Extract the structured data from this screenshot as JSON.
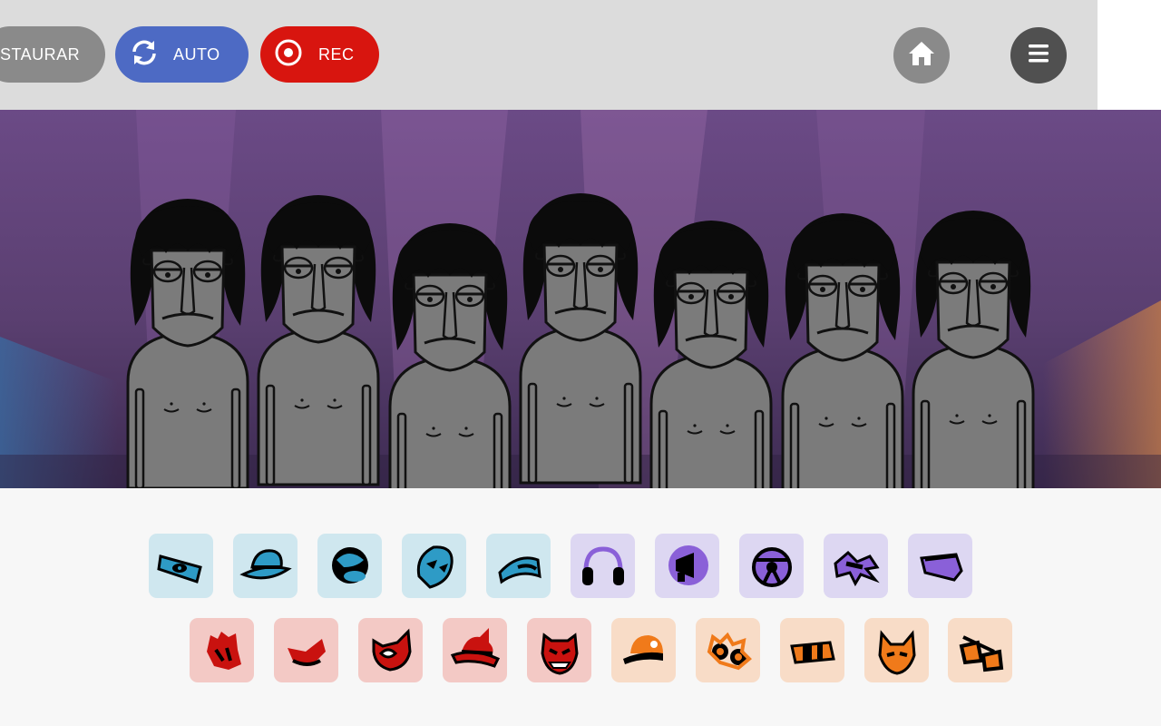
{
  "topbar": {
    "restore_label": "STAURAR",
    "auto_label": "AUTO",
    "rec_label": "REC"
  },
  "colors": {
    "topbar": "#dcdcdc",
    "restore": "#8a8a8a",
    "auto": "#4d6ac4",
    "rec": "#d8150f",
    "home": "#8a8a8a",
    "menu": "#505050",
    "stage_bg": "#5a3f6e",
    "character_skin": "#7b7b7b",
    "tile_beats": "#cfe7ef",
    "tile_effects": "#ddd7f2",
    "tile_melodies": "#f3c9c5",
    "tile_voices": "#f8dcc7"
  },
  "stage": {
    "character_count": 7,
    "character_name": "polo-character"
  },
  "sound_icons": {
    "row1": [
      {
        "name": "beat-blindfold-icon",
        "group": "beats"
      },
      {
        "name": "beat-fedora-icon",
        "group": "beats"
      },
      {
        "name": "beat-cap-icon",
        "group": "beats"
      },
      {
        "name": "beat-mask-icon",
        "group": "beats"
      },
      {
        "name": "beat-visor-icon",
        "group": "beats"
      },
      {
        "name": "effect-headphones-icon",
        "group": "effects"
      },
      {
        "name": "effect-megaphone-icon",
        "group": "effects"
      },
      {
        "name": "effect-wheel-icon",
        "group": "effects"
      },
      {
        "name": "effect-bird-icon",
        "group": "effects"
      },
      {
        "name": "effect-bandana-icon",
        "group": "effects"
      }
    ],
    "row2": [
      {
        "name": "melody-glove-icon",
        "group": "melodies"
      },
      {
        "name": "melody-beret-icon",
        "group": "melodies"
      },
      {
        "name": "melody-catmask-icon",
        "group": "melodies"
      },
      {
        "name": "melody-hornhat-icon",
        "group": "melodies"
      },
      {
        "name": "melody-demonmask-icon",
        "group": "melodies"
      },
      {
        "name": "voice-cap-icon",
        "group": "voices"
      },
      {
        "name": "voice-goggles-icon",
        "group": "voices"
      },
      {
        "name": "voice-headband-icon",
        "group": "voices"
      },
      {
        "name": "voice-foxmask-icon",
        "group": "voices"
      },
      {
        "name": "voice-sunglasses-icon",
        "group": "voices"
      }
    ]
  }
}
